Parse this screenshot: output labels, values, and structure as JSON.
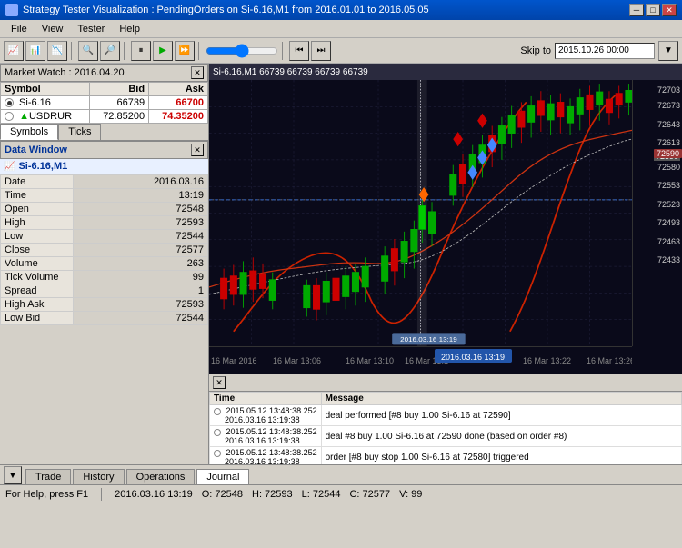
{
  "titleBar": {
    "title": "Strategy Tester Visualization : PendingOrders on Si-6.16,M1 from 2016.01.01 to 2016.05.05",
    "icon": "chart-icon"
  },
  "menuBar": {
    "items": [
      "File",
      "View",
      "Tester",
      "Help"
    ]
  },
  "toolbar": {
    "skipToLabel": "Skip to",
    "skipToValue": "2015.10.26 00:00"
  },
  "marketWatch": {
    "title": "Market Watch : 2016.04.20",
    "headers": [
      "Symbol",
      "Bid",
      "Ask"
    ],
    "rows": [
      {
        "symbol": "Si-6.16",
        "bid": "66739",
        "ask": "66700",
        "radio": true,
        "selected": true
      },
      {
        "symbol": "USDRUR",
        "bid": "72.85200",
        "ask": "74.35200",
        "radio": true,
        "selected": false,
        "green": true
      }
    ],
    "tabs": [
      "Symbols",
      "Ticks"
    ]
  },
  "dataWindow": {
    "title": "Data Window",
    "symbol": "Si-6.16,M1",
    "fields": [
      {
        "label": "Date",
        "value": "2016.03.16"
      },
      {
        "label": "Time",
        "value": "13:19"
      },
      {
        "label": "Open",
        "value": "72548"
      },
      {
        "label": "High",
        "value": "72593"
      },
      {
        "label": "Low",
        "value": "72544"
      },
      {
        "label": "Close",
        "value": "72577"
      },
      {
        "label": "Volume",
        "value": "263"
      },
      {
        "label": "Tick Volume",
        "value": "99"
      },
      {
        "label": "Spread",
        "value": "1"
      },
      {
        "label": "High Ask",
        "value": "72593"
      },
      {
        "label": "Low Bid",
        "value": "72544"
      }
    ]
  },
  "chart": {
    "headerText": "Si-6.16,M1  66739 66739 66739 66739",
    "priceLabels": [
      {
        "value": "72703",
        "y_pct": 3
      },
      {
        "value": "72673",
        "y_pct": 9
      },
      {
        "value": "72643",
        "y_pct": 15
      },
      {
        "value": "72613",
        "y_pct": 21
      },
      {
        "value": "72590",
        "y_pct": 27,
        "highlight": true
      },
      {
        "value": "72580",
        "y_pct": 29
      },
      {
        "value": "72553",
        "y_pct": 35
      },
      {
        "value": "72523",
        "y_pct": 41
      },
      {
        "value": "72493",
        "y_pct": 47
      },
      {
        "value": "72463",
        "y_pct": 53
      },
      {
        "value": "72433",
        "y_pct": 59
      }
    ],
    "timeLabels": [
      "16 Mar 2016",
      "16 Mar 13:06",
      "16 Mar 13:10",
      "16 Mar 13:1",
      "2016.03.16 13:19",
      "16 Mar 13:22",
      "16 Mar 13:26",
      "16 Mar 13:30"
    ]
  },
  "log": {
    "headers": [
      "Time",
      "Message"
    ],
    "rows": [
      {
        "time1": "2015.05.12 13:48:38.252",
        "time2": "2016.03.16 13:19:38",
        "message": "deal performed [#8 buy 1.00 Si-6.16 at 72590]"
      },
      {
        "time1": "2015.05.12 13:48:38.252",
        "time2": "2016.03.16 13:19:38",
        "message": "deal #8 buy 1.00 Si-6.16 at 72590 done (based on order #8)"
      },
      {
        "time1": "2015.05.12 13:48:38.252",
        "time2": "2016.03.16 13:19:38",
        "message": "order [#8 buy stop 1.00 Si-6.16 at 72580] triggered"
      }
    ]
  },
  "bottomTabs": {
    "items": [
      "Trade",
      "History",
      "Operations",
      "Journal"
    ],
    "active": "Journal"
  },
  "statusBar": {
    "help": "For Help, press F1",
    "datetime": "2016.03.16 13:19",
    "open": "O: 72548",
    "high": "H: 72593",
    "low": "L: 72544",
    "close": "C: 72577",
    "volume": "V: 99"
  }
}
